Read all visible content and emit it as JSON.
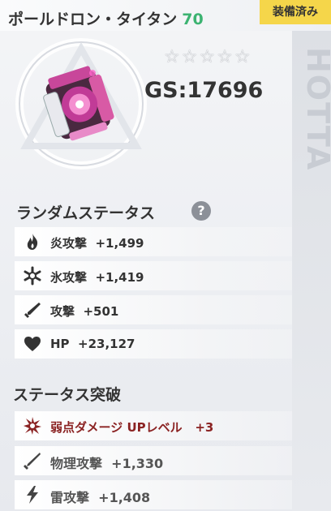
{
  "item": {
    "name": "ポールドロン・タイタン",
    "level": "70",
    "equipped_label": "装備済み",
    "stars": "☆☆☆☆☆",
    "gs": "GS:17696",
    "watermark": "HOTTA"
  },
  "random_status": {
    "title": "ランダムステータス",
    "help": "?",
    "rows": [
      {
        "label": "炎攻撃",
        "value": "+1,499"
      },
      {
        "label": "氷攻撃",
        "value": "+1,419"
      },
      {
        "label": "攻撃",
        "value": "+501"
      },
      {
        "label": "HP",
        "value": "+23,127"
      }
    ]
  },
  "breakthrough": {
    "title": "ステータス突破",
    "rows": [
      {
        "label": "弱点ダメージ UPレベル",
        "value": "+3"
      },
      {
        "label": "物理攻撃",
        "value": "+1,330"
      },
      {
        "label": "雷攻撃",
        "value": "+1,408"
      }
    ]
  },
  "colors": {
    "level_green": "#3cb371",
    "equipped_yellow": "#f5d64a",
    "highlight_red": "#8b2323"
  }
}
